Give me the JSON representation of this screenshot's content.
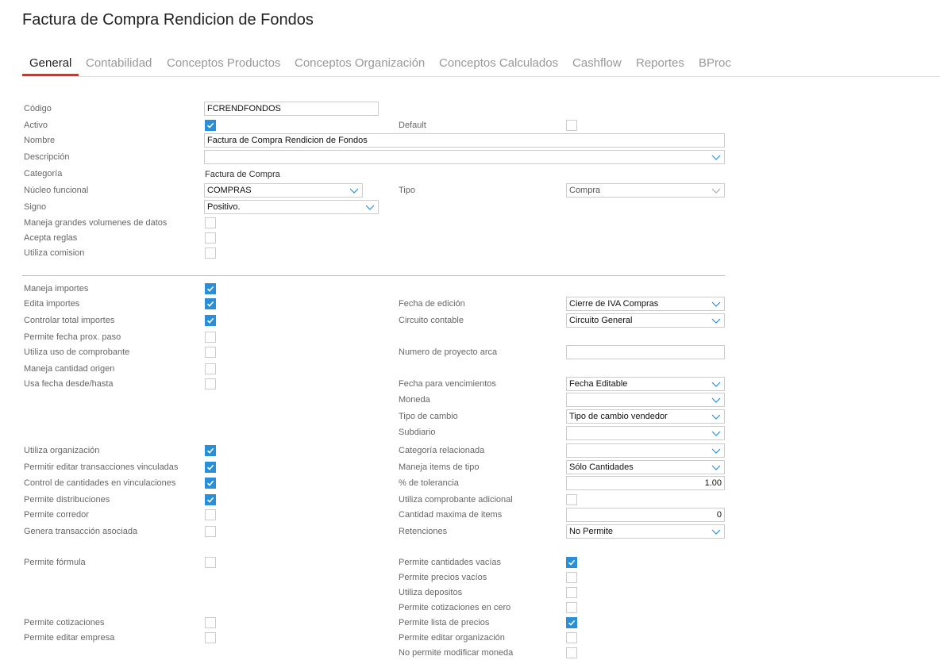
{
  "page": {
    "title": "Factura de Compra Rendicion de Fondos"
  },
  "tabs": [
    {
      "label": "General"
    },
    {
      "label": "Contabilidad"
    },
    {
      "label": "Conceptos Productos"
    },
    {
      "label": "Conceptos Organización"
    },
    {
      "label": "Conceptos Calculados"
    },
    {
      "label": "Cashflow"
    },
    {
      "label": "Reportes"
    },
    {
      "label": "BProc"
    }
  ],
  "labels": {
    "codigo": "Código",
    "activo": "Activo",
    "default": "Default",
    "nombre": "Nombre",
    "descripcion": "Descripción",
    "categoria": "Categoría",
    "nucleo": "Núcleo funcional",
    "tipo": "Tipo",
    "signo": "Signo",
    "maneja_grandes": "Maneja grandes volumenes de datos",
    "acepta_reglas": "Acepta reglas",
    "utiliza_comision": "Utiliza comision",
    "maneja_importes": "Maneja importes",
    "edita_importes": "Edita importes",
    "controlar_total": "Controlar total importes",
    "permite_fecha_prox": "Permite fecha prox. paso",
    "utiliza_uso": "Utiliza uso de comprobante",
    "maneja_cantidad_origen": "Maneja cantidad origen",
    "usa_fecha_desde": "Usa fecha desde/hasta",
    "fecha_edicion": "Fecha de edición",
    "circuito_contable": "Circuito contable",
    "numero_proyecto": "Numero de proyecto arca",
    "fecha_vencimientos": "Fecha para vencimientos",
    "moneda": "Moneda",
    "tipo_cambio": "Tipo de cambio",
    "subdiario": "Subdiario",
    "utiliza_organizacion": "Utiliza organización",
    "permitir_editar_trans": "Permitir editar transacciones vinculadas",
    "control_cantidades": "Control de cantidades en vinculaciones",
    "permite_distribuciones": "Permite distribuciones",
    "permite_corredor": "Permite corredor",
    "genera_transaccion": "Genera transacción asociada",
    "categoria_relacionada": "Categoría relacionada",
    "maneja_items": "Maneja items de tipo",
    "tolerancia": "% de tolerancia",
    "utiliza_comp_adicional": "Utiliza comprobante adicional",
    "cantidad_maxima": "Cantidad maxima de items",
    "retenciones": "Retenciones",
    "permite_formula": "Permite fórmula",
    "permite_cant_vacias": "Permite cantidades vacías",
    "permite_precios_vacios": "Permite precios vacíos",
    "utiliza_depositos": "Utiliza depositos",
    "permite_cot_cero": "Permite cotizaciones en cero",
    "permite_cotizaciones": "Permite cotizaciones",
    "permite_lista_precios": "Permite lista de precios",
    "permite_editar_empresa": "Permite editar empresa",
    "permite_editar_org": "Permite editar organización",
    "no_permite_moneda": "No permite modificar moneda"
  },
  "values": {
    "codigo": "FCRENDFONDOS",
    "nombre": "Factura de Compra Rendicion de Fondos",
    "descripcion": "",
    "categoria": "Factura de Compra",
    "nucleo": "COMPRAS",
    "tipo": "Compra",
    "signo": "Positivo.",
    "fecha_edicion": "Cierre de IVA Compras",
    "circuito_contable": "Circuito General",
    "numero_proyecto": "",
    "fecha_vencimientos": "Fecha Editable",
    "moneda": "",
    "tipo_cambio": "Tipo de cambio vendedor",
    "subdiario": "",
    "categoria_relacionada": "",
    "maneja_items": "Sólo Cantidades",
    "tolerancia": "1.00",
    "cantidad_maxima": "0",
    "retenciones": "No Permite"
  },
  "checks": {
    "activo": true,
    "default": false,
    "maneja_grandes": false,
    "acepta_reglas": false,
    "utiliza_comision": false,
    "maneja_importes": true,
    "edita_importes": true,
    "controlar_total": true,
    "permite_fecha_prox": false,
    "utiliza_uso": false,
    "maneja_cantidad_origen": false,
    "usa_fecha_desde": false,
    "utiliza_organizacion": true,
    "permitir_editar_trans": true,
    "control_cantidades": true,
    "permite_distribuciones": true,
    "permite_corredor": false,
    "genera_transaccion": false,
    "utiliza_comp_adicional": false,
    "permite_formula": false,
    "permite_cant_vacias": true,
    "permite_precios_vacios": false,
    "utiliza_depositos": false,
    "permite_cot_cero": false,
    "permite_cotizaciones": false,
    "permite_lista_precios": true,
    "permite_editar_empresa": false,
    "permite_editar_org": false,
    "no_permite_moneda": false
  },
  "colors": {
    "accent": "#e0311f",
    "checkbox": "#2a8fd6"
  }
}
